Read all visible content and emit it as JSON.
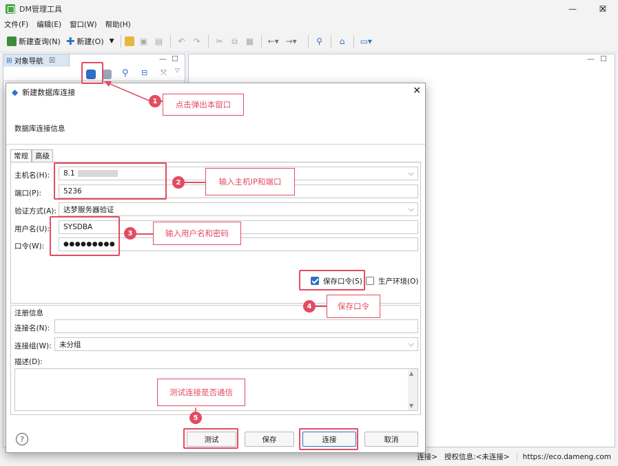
{
  "app": {
    "title": "DM管理工具"
  },
  "window_controls": {
    "min": "—",
    "max": "☐",
    "close": "✕"
  },
  "menu": [
    "文件(F)",
    "编辑(E)",
    "窗口(W)",
    "帮助(H)"
  ],
  "toolbar": {
    "new_query": "新建查询(N)",
    "new": "新建(O)"
  },
  "nav": {
    "tab_label": "对象导航",
    "tab_close": "☒"
  },
  "status": {
    "auth": "授权信息:<未连接>",
    "url": "https://eco.dameng.com",
    "partial": "连接>"
  },
  "dialog": {
    "title": "新建数据库连接",
    "subtitle": "数据库连接信息",
    "tabs": [
      "常规",
      "高级"
    ],
    "fields": {
      "host_label": "主机名(H):",
      "host_value": "8.1",
      "port_label": "端口(P):",
      "port_value": "5236",
      "auth_label": "验证方式(A):",
      "auth_value": "达梦服务器验证",
      "user_label": "用户名(U):",
      "user_value": "SYSDBA",
      "pwd_label": "口令(W):",
      "pwd_value": "●●●●●●●●●"
    },
    "save_pwd": {
      "label": "保存口令(S)",
      "checked": true
    },
    "prod_env": {
      "label": "生产环境(O)",
      "checked": false
    },
    "register": {
      "section": "注册信息",
      "conn_name_label": "连接名(N):",
      "conn_name_value": "",
      "group_label": "连接组(W):",
      "group_value": "未分组",
      "desc_label": "描述(D):"
    },
    "buttons": {
      "test": "测试",
      "save": "保存",
      "connect": "连接",
      "cancel": "取消"
    },
    "help": "?"
  },
  "annotations": [
    {
      "num": "1",
      "text": "点击弹出本窗口"
    },
    {
      "num": "2",
      "text": "输入主机IP和端口"
    },
    {
      "num": "3",
      "text": "输入用户名和密码"
    },
    {
      "num": "4",
      "text": "保存口令"
    },
    {
      "num": "5",
      "text": "测试连接是否通信"
    }
  ],
  "colors": {
    "annotation": "#e34b61",
    "accent": "#2f6fc4",
    "tab_bg": "#dae6f3"
  }
}
